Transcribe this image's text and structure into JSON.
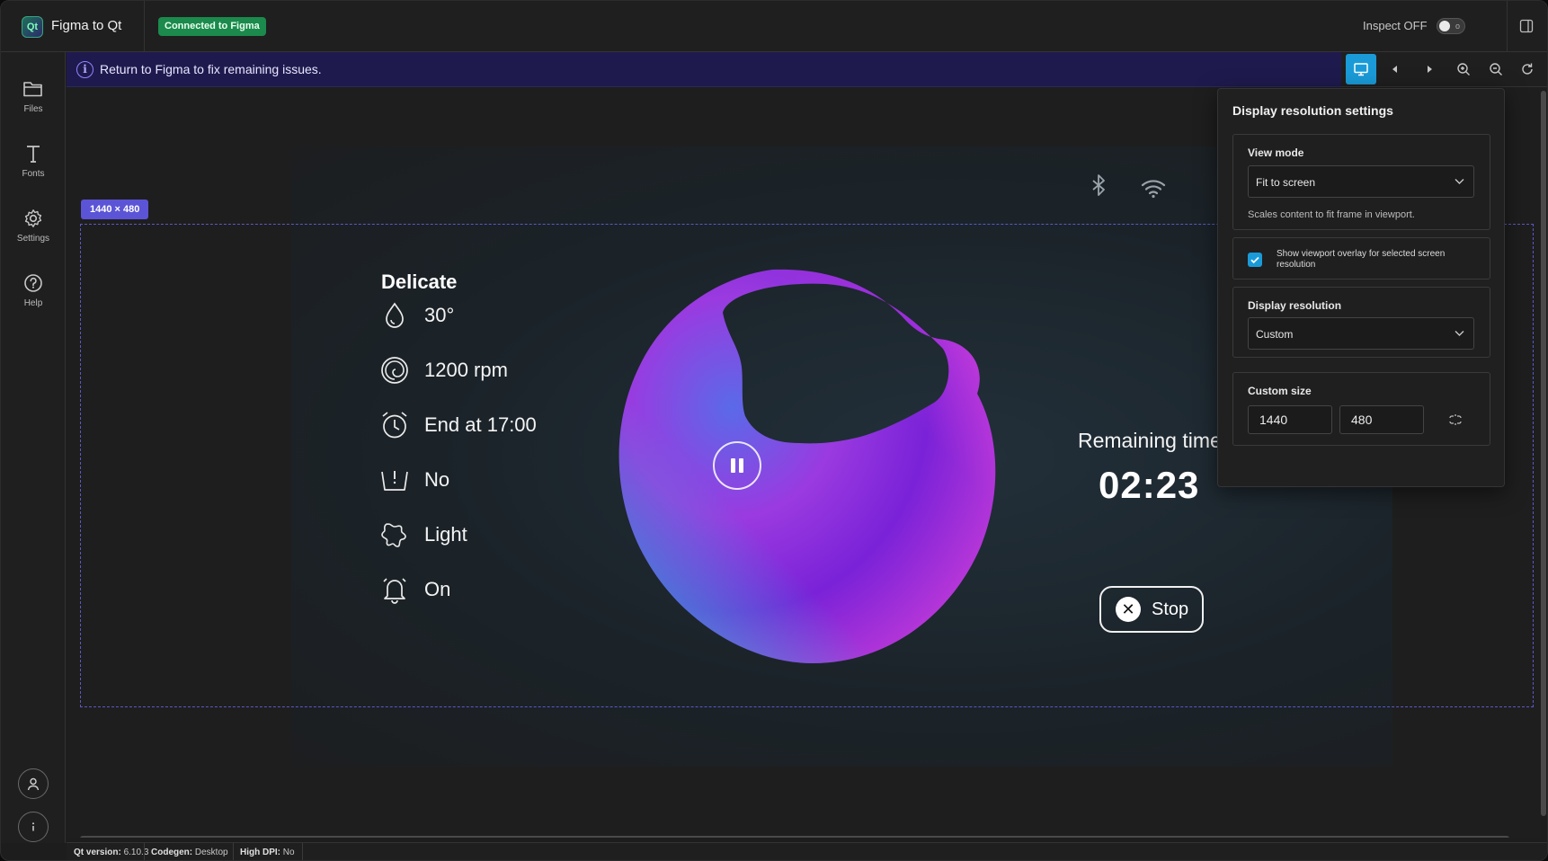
{
  "titlebar": {
    "logo_text": "Qt",
    "app_title": "Figma to Qt",
    "connection_badge": "Connected to Figma",
    "inspect_label": "Inspect OFF",
    "inspect_enabled": false
  },
  "sidebar": {
    "items": [
      {
        "label": "Files",
        "icon": "folder-icon"
      },
      {
        "label": "Fonts",
        "icon": "text-icon"
      },
      {
        "label": "Settings",
        "icon": "gear-icon"
      },
      {
        "label": "Help",
        "icon": "help-icon"
      }
    ],
    "bottom": [
      {
        "icon": "user-icon"
      },
      {
        "icon": "info-icon"
      }
    ]
  },
  "infobar": {
    "message": "Return to Figma to fix remaining issues."
  },
  "toolbar": {
    "buttons": [
      "display-icon",
      "prev-icon",
      "next-icon",
      "zoom-in-icon",
      "zoom-out-icon",
      "reset-icon"
    ],
    "active": "display-icon"
  },
  "canvas": {
    "frame_size_badge": "1440 × 480",
    "wash": {
      "program": "Delicate",
      "properties": [
        {
          "icon": "water-drop-icon",
          "value": "30°"
        },
        {
          "icon": "spin-icon",
          "value": "1200 rpm"
        },
        {
          "icon": "alarm-clock-icon",
          "value": "End at 17:00"
        },
        {
          "icon": "basin-icon",
          "value": "No"
        },
        {
          "icon": "stain-icon",
          "value": "Light"
        },
        {
          "icon": "bell-icon",
          "value": "On"
        }
      ],
      "remaining_label": "Remaining time",
      "remaining_time": "02:23",
      "stop_label": "Stop"
    }
  },
  "popover": {
    "title": "Display resolution settings",
    "view_mode": {
      "label": "View mode",
      "value": "Fit to screen",
      "hint": "Scales content to fit frame in viewport."
    },
    "overlay_checkbox": {
      "label": "Show viewport overlay for selected screen resolution",
      "checked": true
    },
    "display_resolution": {
      "label": "Display resolution",
      "value": "Custom"
    },
    "custom_size": {
      "label": "Custom size",
      "width": "1440",
      "height": "480"
    }
  },
  "statusbar": {
    "qt_version_label": "Qt version:",
    "qt_version": "6.10.3",
    "codegen_label": "Codegen:",
    "codegen": "Desktop",
    "high_dpi_label": "High DPI:",
    "high_dpi": "No"
  },
  "colors": {
    "accent": "#1a9bd8",
    "badge_green": "#1b8a4c",
    "infobar": "#1f1a4e",
    "frame_badge": "#5b54d6"
  }
}
